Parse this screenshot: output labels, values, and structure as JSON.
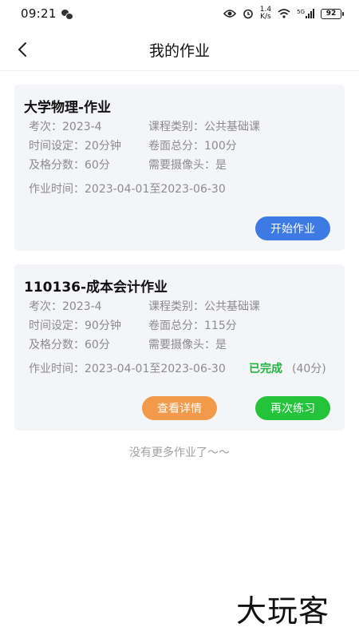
{
  "status_bar": {
    "time": "09:21",
    "speed_value": "1.4",
    "speed_unit": "K/s",
    "battery": "92",
    "network_label": "5G"
  },
  "header": {
    "title": "我的作业"
  },
  "assignments": [
    {
      "title": "大学物理-作业",
      "exam_period": "考次：2023-4",
      "course_type": "课程类别：公共基础课",
      "time_limit": "时间设定：20分钟",
      "total_score": "卷面总分：100分",
      "pass_score": "及格分数：60分",
      "camera": "需要摄像头：是",
      "work_time": "作业时间：2023-04-01至2023-06-30",
      "start_button": "开始作业"
    },
    {
      "title": "110136-成本会计作业",
      "exam_period": "考次：2023-4",
      "course_type": "课程类别：公共基础课",
      "time_limit": "时间设定：90分钟",
      "total_score": "卷面总分：115分",
      "pass_score": "及格分数：60分",
      "camera": "需要摄像头：是",
      "work_time": "作业时间：2023-04-01至2023-06-30",
      "status": "已完成",
      "score": "(40分)",
      "detail_button": "查看详情",
      "retry_button": "再次练习"
    }
  ],
  "footer": {
    "no_more_text": "没有更多作业了～～"
  },
  "watermark": "大玩客"
}
